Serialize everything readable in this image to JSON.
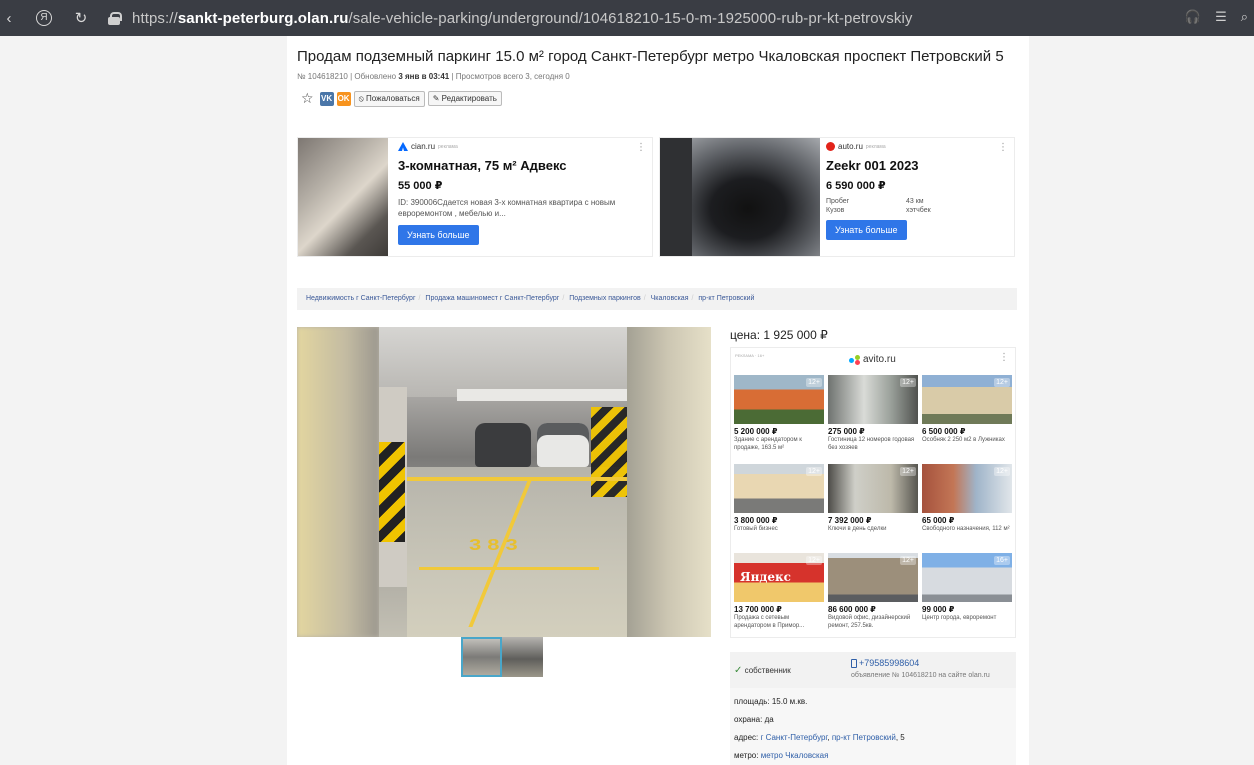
{
  "browser": {
    "url_prefix": "https://",
    "url_host": "sankt-peterburg.olan.ru",
    "url_path": "/sale-vehicle-parking/underground/104618210-15-0-m-1925000-rub-pr-kt-petrovskiy",
    "yandex_letter": "Я"
  },
  "listing": {
    "title": "Продам подземный паркинг 15.0 м² город Санкт-Петербург метро Чкаловская проспект Петровский 5",
    "meta_pre": "№ 104618210 | Обновлено ",
    "meta_updated": "3 янв в 03:41",
    "meta_post": " | Просмотров всего 3, сегодня 0",
    "social_vk": "VK",
    "social_ok": "OK",
    "complain_label": "⦸ Пожаловаться",
    "edit_label": "✎ Редактировать",
    "price_label": "цена: ",
    "price_value": "1 925 000 ₽"
  },
  "ads": [
    {
      "source": "cian.ru",
      "tag": "реклама",
      "title": "3-комнатная, 75 м² Адвекс",
      "price": "55 000 ₽",
      "desc": "ID: 390006Сдается новая 3-х комнатная квартира с новым евроремонтом , мебелью и...",
      "cta": "Узнать больше"
    },
    {
      "source": "auto.ru",
      "tag": "реклама",
      "title": "Zeekr 001 2023",
      "price": "6 590 000 ₽",
      "kv": [
        {
          "k": "Пробег",
          "v": "43 км"
        },
        {
          "k": "Кузов",
          "v": "хэтчбек"
        }
      ],
      "cta": "Узнать больше"
    }
  ],
  "breadcrumbs": [
    "Недвижимость г Санкт-Петербург",
    "Продажа машиномест г Санкт-Петербург",
    "Подземных паркингов",
    "Чкаловская",
    "пр-кт Петровский"
  ],
  "photo": {
    "spot_number": "383"
  },
  "avito": {
    "tag": "реклама · 16+",
    "source": "avito.ru",
    "tiles": [
      {
        "price": "5 200 000 ₽",
        "desc": "Здание с арендатором к продаже, 163.5 м²",
        "age": "12+"
      },
      {
        "price": "275 000 ₽",
        "desc": "Гостиница 12 номеров годовая без хозяев",
        "age": "12+"
      },
      {
        "price": "6 500 000 ₽",
        "desc": "Особняк 2 250 м2 в Лужниках",
        "age": "12+"
      },
      {
        "price": "3 800 000 ₽",
        "desc": "Готовый бизнес",
        "age": "12+"
      },
      {
        "price": "7 392 000 ₽",
        "desc": "Ключи в день сделки",
        "age": "12+"
      },
      {
        "price": "65 000 ₽",
        "desc": "Свободного назначения, 112 м²",
        "age": "12+"
      },
      {
        "price": "13 700 000 ₽",
        "desc": "Продажа с сетевым арендатором в Примор...",
        "age": "12+",
        "img_text": "Яндекс"
      },
      {
        "price": "86 600 000 ₽",
        "desc": "Видовой офис, дизайнерский ремонт, 257.5кв.",
        "age": "12+"
      },
      {
        "price": "99 000 ₽",
        "desc": "Центр города, евроремонт",
        "age": "16+"
      }
    ]
  },
  "owner": {
    "label": "собственник",
    "phone": "+79585998604",
    "ad_number": "объявление № 104618210 на сайте olan.ru"
  },
  "details": {
    "area_label": "площадь: ",
    "area_value": "15.0 м.кв.",
    "guard_label": "охрана: ",
    "guard_value": "да",
    "address_label": "адрес: ",
    "address_city": "г Санкт-Петербург",
    "address_sep": ", ",
    "address_street": "пр-кт Петровский",
    "address_house": ", 5",
    "metro_label": "метро: ",
    "metro_value": "метро Чкаловская"
  }
}
